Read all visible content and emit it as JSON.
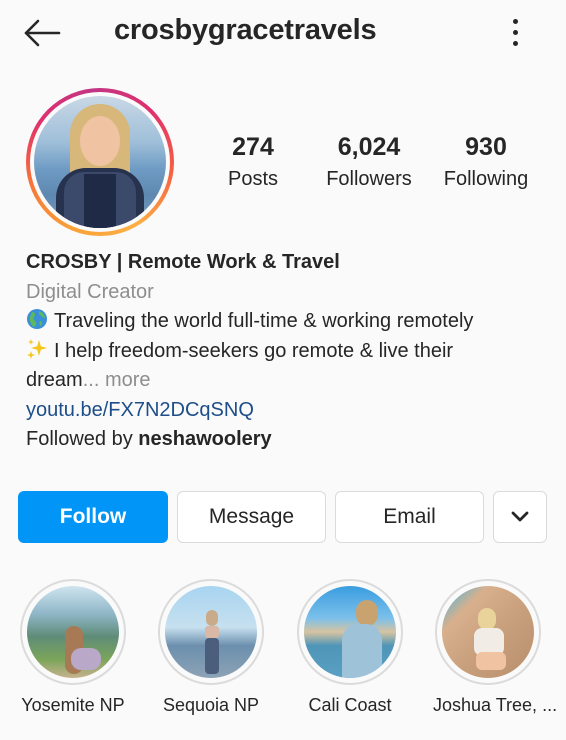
{
  "header": {
    "username": "crosbygracetravels",
    "back_icon": "arrow-left-icon",
    "menu_icon": "more-vertical-icon"
  },
  "profile": {
    "avatar": "profile-photo",
    "story_ring_colors": [
      "#fcaf45",
      "#f77737",
      "#e1306c",
      "#c13584"
    ]
  },
  "stats": [
    {
      "value": "274",
      "label": "Posts"
    },
    {
      "value": "6,024",
      "label": "Followers"
    },
    {
      "value": "930",
      "label": "Following"
    }
  ],
  "bio": {
    "name": "CROSBY | Remote Work & Travel",
    "category": "Digital Creator",
    "line1_emoji": "globe-americas-icon",
    "line1": "Traveling the world full-time & working remotely",
    "line2_emoji": "sparkles-icon",
    "line2": "I help freedom-seekers go remote & live their",
    "line3": "dream",
    "ellipsis": "...",
    "more": "more",
    "link": "youtu.be/FX7N2DCqSNQ",
    "followed_by_prefix": "Followed by ",
    "followed_by_user": "neshawoolery"
  },
  "actions": {
    "follow": "Follow",
    "message": "Message",
    "email": "Email",
    "dropdown_icon": "chevron-down-icon",
    "follow_color": "#0095f6"
  },
  "highlights": [
    {
      "label": "Yosemite NP"
    },
    {
      "label": "Sequoia NP"
    },
    {
      "label": "Cali Coast"
    },
    {
      "label": "Joshua Tree, ..."
    }
  ]
}
